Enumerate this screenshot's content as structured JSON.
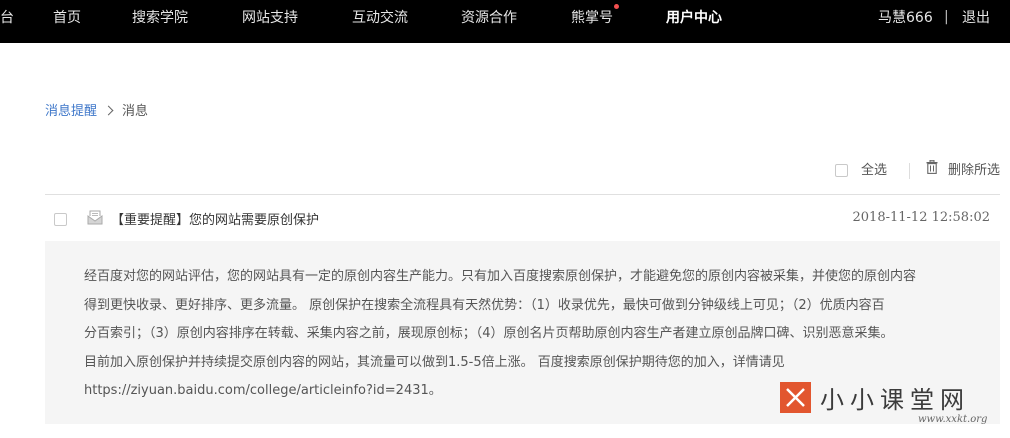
{
  "nav": {
    "items": [
      {
        "label": "台"
      },
      {
        "label": "首页"
      },
      {
        "label": "搜索学院"
      },
      {
        "label": "网站支持"
      },
      {
        "label": "互动交流"
      },
      {
        "label": "资源合作"
      },
      {
        "label": "熊掌号"
      },
      {
        "label": "用户中心"
      }
    ],
    "active": "用户中心",
    "username": "马慧666",
    "separator": "|",
    "logout": "退出"
  },
  "breadcrumb": {
    "parent": "消息提醒",
    "current": "消息"
  },
  "toolbar": {
    "select_all": "全选",
    "delete_all": "删除所选"
  },
  "message": {
    "title": "【重要提醒】您的网站需要原创保护",
    "time": "2018-11-12 12:58:02",
    "body_lines": [
      "经百度对您的网站评估，您的网站具有一定的原创内容生产能力。只有加入百度搜索原创保护，才能避免您的原创内容被采集，并使您的原创内容",
      "得到更快收录、更好排序、更多流量。 原创保护在搜索全流程具有天然优势：（1）收录优先，最快可做到分钟级线上可见；（2）优质内容百",
      "分百索引；（3）原创内容排序在转载、采集内容之前，展现原创标；（4）原创名片页帮助原创内容生产者建立原创品牌口碑、识别恶意采集。",
      "目前加入原创保护并持续提交原创内容的网站，其流量可以做到1.5-5倍上涨。 百度搜索原创保护期待您的加入，详情请见",
      "https://ziyuan.baidu.com/college/articleinfo?id=2431。"
    ]
  },
  "watermark": {
    "text": "小小课堂网",
    "url": "www.xxkt.org"
  },
  "colors": {
    "nav_bg": "#000000",
    "link": "#3d76c9",
    "notify_dot": "#f24f4f",
    "panel_bg": "#f5f5f5",
    "watermark_accent": "#e2562f"
  }
}
